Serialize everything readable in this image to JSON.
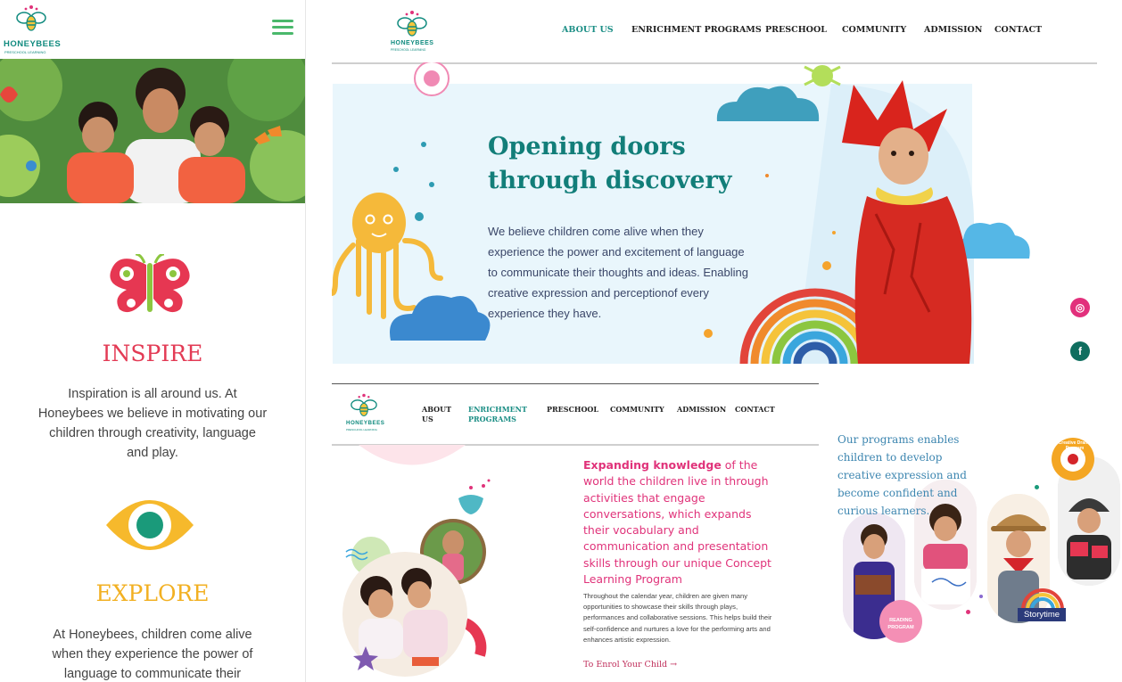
{
  "mobile": {
    "logo": {
      "name": "HONEYBEES",
      "tagline": "PRESCHOOL LEARNING"
    },
    "sections": [
      {
        "title": "INSPIRE",
        "text": "Inspiration is all around us. At Honeybees we believe in motivating our children through creativity, language and play.",
        "color": "#e33b55"
      },
      {
        "title": "EXPLORE",
        "text": "At Honeybees, children come alive when they experience the power of language to communicate their",
        "color": "#f2b022"
      }
    ]
  },
  "desktop_top": {
    "logo": {
      "name": "HONEYBEES",
      "tagline": "PRESCHOOL LEARNING"
    },
    "nav": [
      "ABOUT US",
      "ENRICHMENT PROGRAMS",
      "PRESCHOOL",
      "COMMUNITY",
      "ADMISSION",
      "CONTACT"
    ],
    "active_nav": "ABOUT US",
    "hero_title_line1": "Opening doors",
    "hero_title_line2": "through discovery",
    "hero_text": "We believe children come alive when they experience the power and excitement of language to communicate their thoughts and ideas. Enabling creative expression and perceptionof every experience they have."
  },
  "desktop_bottom": {
    "logo": {
      "name": "HONEYBEES",
      "tagline": "PRESCHOOL LEARNING"
    },
    "nav": {
      "about_line1": "ABOUT",
      "about_line2": "US",
      "enrich_line1": "ENRICHMENT",
      "enrich_line2": "PROGRAMS",
      "preschool": "PRESCHOOL",
      "community": "COMMUNITY",
      "admission": "ADMISSION",
      "contact": "CONTACT"
    },
    "heading_bold": "Expanding knowledge",
    "heading_rest": " of the world the children live in through activities that engage conversations, which expands their vocabulary and communication and presentation skills through our unique Concept Learning Program",
    "body": "Throughout the calendar year, children are given many opportunities to showcase their skills through plays, performances and collaborative sessions. This helps build their self-confidence and nurtures a love for the performing arts and enhances artistic expression.",
    "enrol_link": "To Enrol Your Child →"
  },
  "programs": {
    "text": "Our programs enables children to develop creative expression and become confident and curious learners.",
    "badge_drama": "Creative Drama Program",
    "badge_reading_line1": "READING",
    "badge_reading_line2": "PROGRAM",
    "storytime": "Storytime"
  },
  "colors": {
    "teal": "#127e79",
    "pink": "#e0337a",
    "nav_active": "#1b8e85",
    "hero_bg": "#e9f6fc"
  }
}
